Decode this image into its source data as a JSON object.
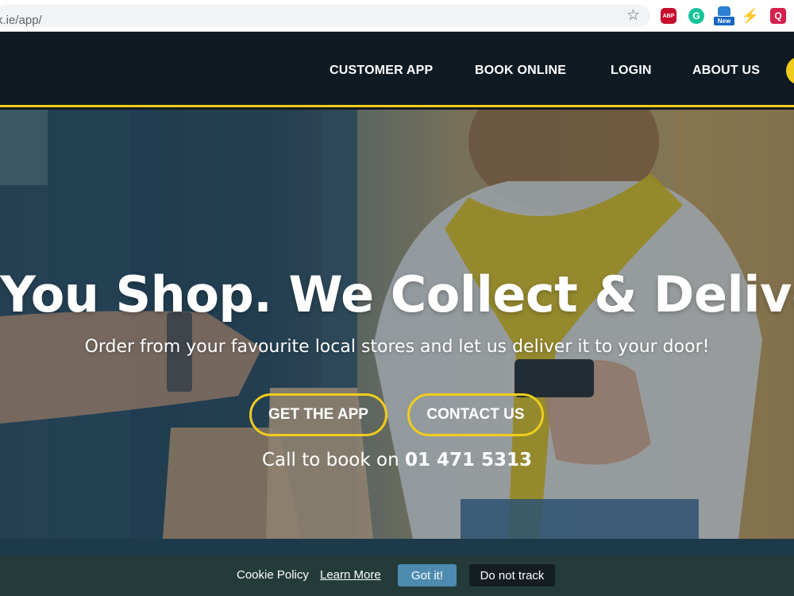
{
  "browser": {
    "url": "k.ie/app/",
    "bookmark_icon": "star-icon",
    "extensions": [
      {
        "name": "adblock-icon",
        "label": "ABP"
      },
      {
        "name": "grammarly-icon",
        "label": "G"
      },
      {
        "name": "new-extension-icon",
        "label": "New"
      },
      {
        "name": "bolt-icon",
        "label": "⚡"
      },
      {
        "name": "red-extension-icon",
        "label": "Q"
      }
    ]
  },
  "nav": {
    "items": [
      {
        "label": "CUSTOMER APP"
      },
      {
        "label": "BOOK ONLINE"
      },
      {
        "label": "LOGIN"
      },
      {
        "label": "ABOUT US"
      }
    ],
    "accent": "#f0cd1c",
    "background": "#0f1a22"
  },
  "hero": {
    "headline": "You Shop. We Collect & Deliver",
    "subheadline": "Order from your favourite local stores and let us deliver it to your door!",
    "buttons": {
      "get_app": "GET THE APP",
      "contact": "CONTACT US"
    },
    "call_prefix": "Call to book on",
    "phone": "01 471 5313"
  },
  "cookie": {
    "text": "Cookie Policy",
    "learn_more": "Learn More",
    "accept": "Got it!",
    "decline": "Do not track"
  }
}
